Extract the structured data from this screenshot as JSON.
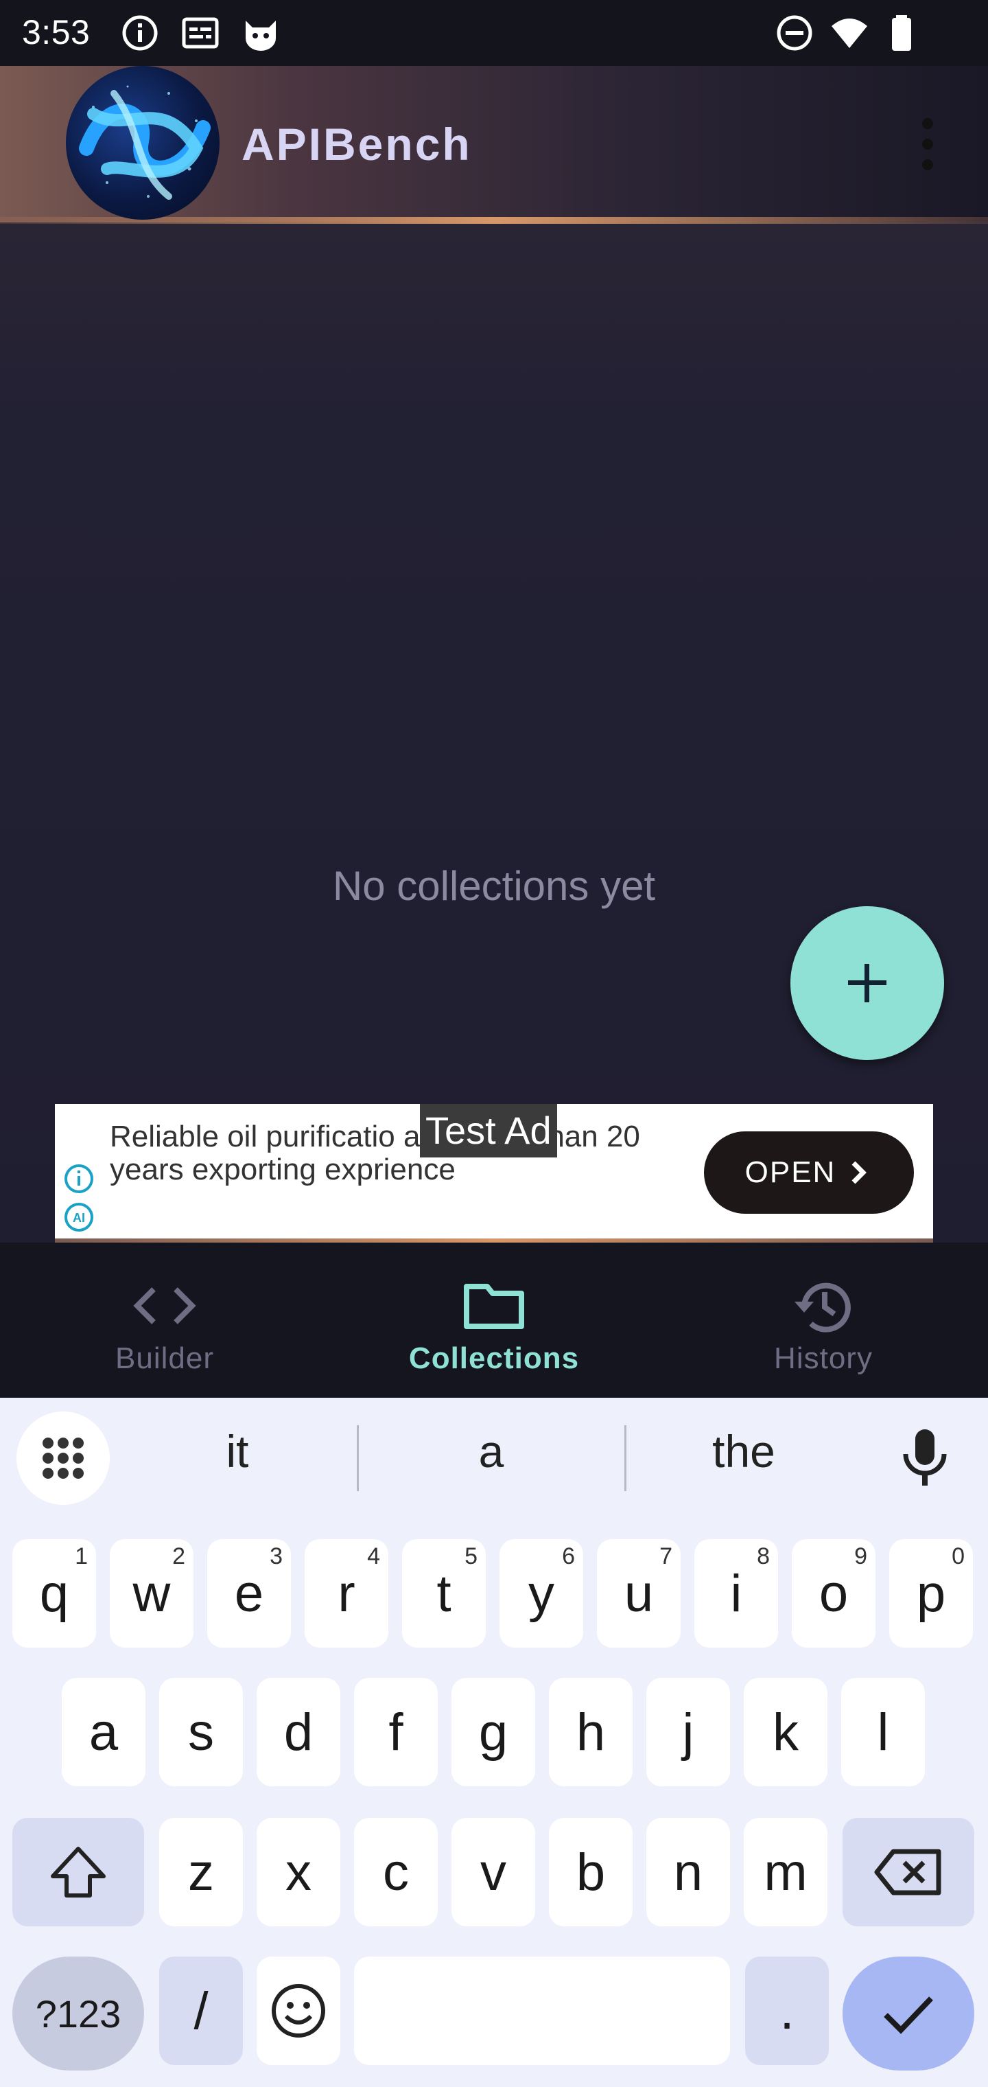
{
  "status_bar": {
    "time": "3:53"
  },
  "app_bar": {
    "title": "APIBench"
  },
  "content": {
    "empty_message": "No collections yet"
  },
  "ad": {
    "label": "Test Ad",
    "text": "Reliable oil purificatio and more than 20 years exporting exprience",
    "button_label": "OPEN"
  },
  "bottom_nav": {
    "items": [
      {
        "label": "Builder",
        "active": false
      },
      {
        "label": "Collections",
        "active": true
      },
      {
        "label": "History",
        "active": false
      }
    ]
  },
  "colors": {
    "accent": "#8ee1d4",
    "inactive": "#6f6d83"
  },
  "keyboard": {
    "suggestions": [
      "it",
      "a",
      "the"
    ],
    "row1": [
      {
        "k": "q",
        "h": "1"
      },
      {
        "k": "w",
        "h": "2"
      },
      {
        "k": "e",
        "h": "3"
      },
      {
        "k": "r",
        "h": "4"
      },
      {
        "k": "t",
        "h": "5"
      },
      {
        "k": "y",
        "h": "6"
      },
      {
        "k": "u",
        "h": "7"
      },
      {
        "k": "i",
        "h": "8"
      },
      {
        "k": "o",
        "h": "9"
      },
      {
        "k": "p",
        "h": "0"
      }
    ],
    "row2": [
      "a",
      "s",
      "d",
      "f",
      "g",
      "h",
      "j",
      "k",
      "l"
    ],
    "row3": [
      "z",
      "x",
      "c",
      "v",
      "b",
      "n",
      "m"
    ],
    "symbols_label": "?123",
    "slash_label": "/",
    "period_label": "."
  }
}
